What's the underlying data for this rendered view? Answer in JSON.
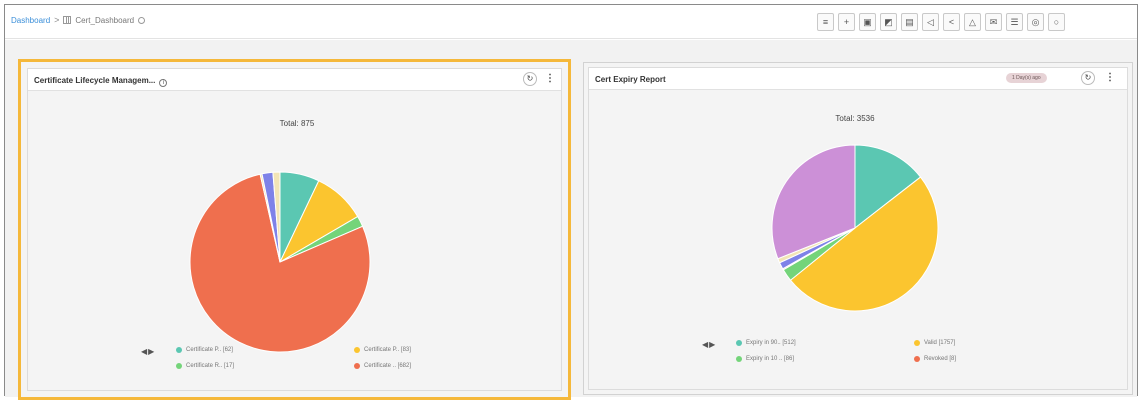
{
  "breadcrumb": {
    "root": "Dashboard",
    "separator": ">",
    "current": "Cert_Dashboard"
  },
  "toolbar": {
    "buttons": [
      {
        "name": "list-icon",
        "glyph": "≡"
      },
      {
        "name": "add-icon",
        "glyph": "+"
      },
      {
        "name": "save-icon",
        "glyph": "▣"
      },
      {
        "name": "save-as-icon",
        "glyph": "◩"
      },
      {
        "name": "delete-icon",
        "glyph": "▤"
      },
      {
        "name": "announce-icon",
        "glyph": "◁"
      },
      {
        "name": "share-icon",
        "glyph": "<"
      },
      {
        "name": "upload-icon",
        "glyph": "△"
      },
      {
        "name": "mail-icon",
        "glyph": "✉"
      },
      {
        "name": "filter-icon",
        "glyph": "☰"
      },
      {
        "name": "settings-icon",
        "glyph": "◎"
      },
      {
        "name": "power-icon",
        "glyph": "○"
      }
    ]
  },
  "colors": {
    "teal": "#5bc7b2",
    "yellow": "#fbc52f",
    "green": "#74d47a",
    "red": "#ef6f4e",
    "purple": "#cc90d7",
    "blue": "#7e82e8",
    "cream": "#f2e4b6",
    "highlight": "#f5b83a"
  },
  "panels": {
    "left": {
      "title": "Certificate Lifecycle Managem...",
      "refresh_glyph": "↻",
      "menu_glyph": "⋮",
      "total": "Total: 875",
      "nav": {
        "prev": "◀",
        "next": "▶"
      },
      "legend": [
        {
          "label": "Certificate P.. [62]",
          "color": "#5bc7b2"
        },
        {
          "label": "Certificate P.. [83]",
          "color": "#fbc52f"
        },
        {
          "label": "Certificate R.. [17]",
          "color": "#74d47a"
        },
        {
          "label": "Certificate .. [682]",
          "color": "#ef6f4e"
        }
      ]
    },
    "right": {
      "title": "Cert Expiry Report",
      "badge": "1 Day(s) ago",
      "refresh_glyph": "↻",
      "menu_glyph": "⋮",
      "total": "Total: 3536",
      "nav": {
        "prev": "◀",
        "next": "▶"
      },
      "legend": [
        {
          "label": "Expiry in 90.. [512]",
          "color": "#5bc7b2"
        },
        {
          "label": "Valid [1757]",
          "color": "#fbc52f"
        },
        {
          "label": "Expiry in 10 .. [86]",
          "color": "#74d47a"
        },
        {
          "label": "Revoked [8]",
          "color": "#ef6f4e"
        }
      ]
    }
  },
  "chart_data": [
    {
      "type": "pie",
      "title": "Total: 875",
      "slices": [
        {
          "label": "Certificate P..",
          "value": 62,
          "color": "#5bc7b2"
        },
        {
          "label": "Certificate P..",
          "value": 83,
          "color": "#fbc52f"
        },
        {
          "label": "Certificate R..",
          "value": 17,
          "color": "#74d47a"
        },
        {
          "label": "Certificate ..",
          "value": 682,
          "color": "#ef6f4e"
        },
        {
          "value": 3,
          "color": "#f2e4b6"
        },
        {
          "value": 17,
          "color": "#7e82e8"
        },
        {
          "value": 11,
          "color": "#f2e4b6"
        }
      ]
    },
    {
      "type": "pie",
      "title": "Total: 3536",
      "slices": [
        {
          "label": "Expiry in 90..",
          "value": 512,
          "color": "#5bc7b2"
        },
        {
          "label": "Valid",
          "value": 1757,
          "color": "#fbc52f"
        },
        {
          "label": "Expiry in 10 ..",
          "value": 86,
          "color": "#74d47a"
        },
        {
          "label": "Revoked",
          "value": 8,
          "color": "#ef6f4e"
        },
        {
          "value": 46,
          "color": "#7e82e8"
        },
        {
          "value": 30,
          "color": "#f2e4b6"
        },
        {
          "value": 1097,
          "color": "#cc90d7"
        }
      ]
    }
  ]
}
